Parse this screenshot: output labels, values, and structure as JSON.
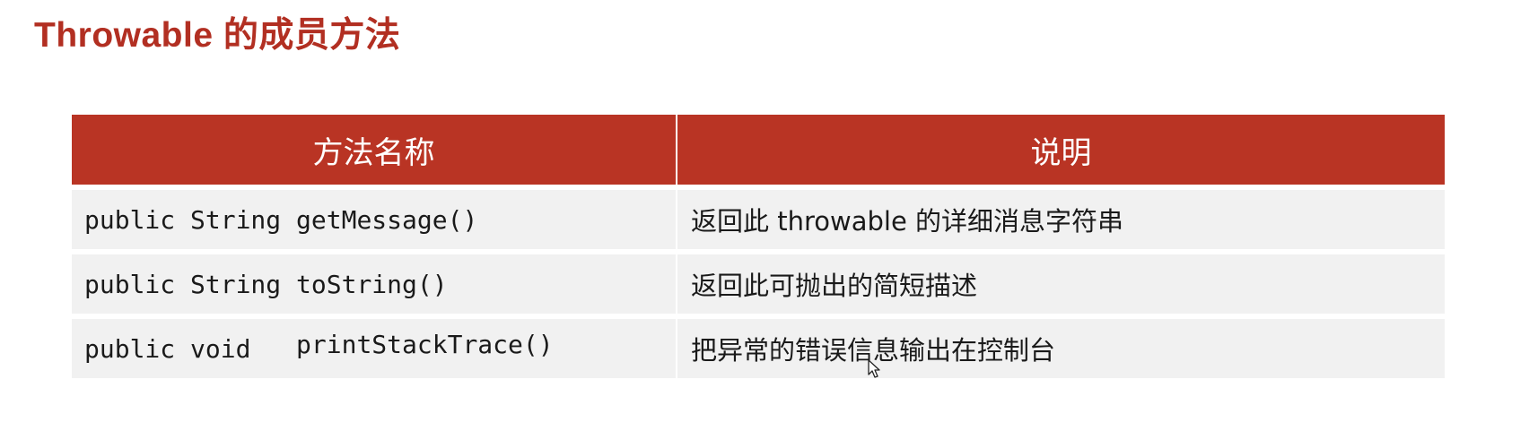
{
  "slide": {
    "title": "Throwable 的成员方法"
  },
  "table": {
    "headers": [
      "方法名称",
      "说明"
    ],
    "rows": [
      {
        "modifier": "public String ",
        "method": "getMessage()",
        "description": "返回此 throwable 的详细消息字符串"
      },
      {
        "modifier": "public String ",
        "method": "toString()",
        "description": "返回此可抛出的简短描述"
      },
      {
        "modifier": "public void   ",
        "method": "printStackTrace()",
        "description": "把异常的错误信息输出在控制台"
      }
    ]
  },
  "colors": {
    "title": "#b22f22",
    "header_bg": "#b93424",
    "row_bg": "#f1f1f1"
  },
  "icons": {
    "cursor": "mouse-pointer-icon"
  }
}
